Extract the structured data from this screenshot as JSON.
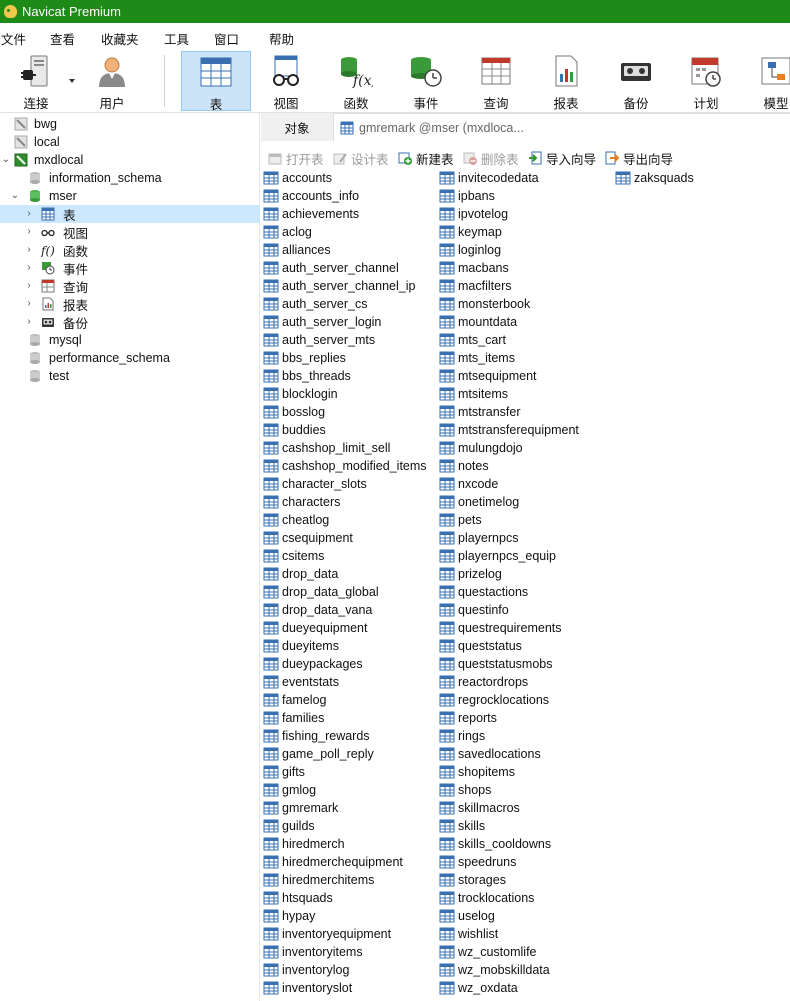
{
  "window": {
    "title": "Navicat Premium"
  },
  "menu": [
    "文件",
    "查看",
    "收藏夹",
    "工具",
    "窗口",
    "帮助"
  ],
  "toolbar": [
    {
      "label": "连接",
      "icon": "connection-plug-icon"
    },
    {
      "label": "用户",
      "icon": "user-icon"
    },
    {
      "label": "表",
      "icon": "table-icon",
      "active": true
    },
    {
      "label": "视图",
      "icon": "view-glasses-icon"
    },
    {
      "label": "函数",
      "icon": "function-icon"
    },
    {
      "label": "事件",
      "icon": "event-clock-icon"
    },
    {
      "label": "查询",
      "icon": "query-icon"
    },
    {
      "label": "报表",
      "icon": "report-icon"
    },
    {
      "label": "备份",
      "icon": "backup-icon"
    },
    {
      "label": "计划",
      "icon": "schedule-calendar-icon"
    },
    {
      "label": "模型",
      "icon": "model-icon"
    }
  ],
  "tree": {
    "connections": [
      {
        "label": "bwg"
      },
      {
        "label": "local"
      },
      {
        "label": "mxdlocal"
      }
    ],
    "databases": [
      {
        "label": "information_schema"
      },
      {
        "label": "mser"
      }
    ],
    "mser_children": [
      {
        "label": "表",
        "icon": "table-icon"
      },
      {
        "label": "视图",
        "icon": "view-glasses-icon"
      },
      {
        "label": "函数",
        "icon": "function-icon"
      },
      {
        "label": "事件",
        "icon": "event-clock-icon"
      },
      {
        "label": "查询",
        "icon": "query-icon"
      },
      {
        "label": "报表",
        "icon": "report-icon"
      },
      {
        "label": "备份",
        "icon": "backup-icon"
      }
    ],
    "other_databases": [
      {
        "label": "mysql"
      },
      {
        "label": "performance_schema"
      },
      {
        "label": "test"
      }
    ]
  },
  "object_tab": {
    "label": "对象",
    "doc_tab_label": "gmremark @mser (mxdloca..."
  },
  "actions": [
    {
      "label": "打开表",
      "enabled": false,
      "icon": "open-table-icon"
    },
    {
      "label": "设计表",
      "enabled": false,
      "icon": "design-table-icon"
    },
    {
      "label": "新建表",
      "enabled": true,
      "icon": "new-table-icon"
    },
    {
      "label": "删除表",
      "enabled": false,
      "icon": "delete-table-icon"
    },
    {
      "label": "导入向导",
      "enabled": true,
      "icon": "import-wizard-icon"
    },
    {
      "label": "导出向导",
      "enabled": true,
      "icon": "export-wizard-icon"
    }
  ],
  "tables": {
    "col1": [
      "accounts",
      "accounts_info",
      "achievements",
      "aclog",
      "alliances",
      "auth_server_channel",
      "auth_server_channel_ip",
      "auth_server_cs",
      "auth_server_login",
      "auth_server_mts",
      "bbs_replies",
      "bbs_threads",
      "blocklogin",
      "bosslog",
      "buddies",
      "cashshop_limit_sell",
      "cashshop_modified_items",
      "character_slots",
      "characters",
      "cheatlog",
      "csequipment",
      "csitems",
      "drop_data",
      "drop_data_global",
      "drop_data_vana",
      "dueyequipment",
      "dueyitems",
      "dueypackages",
      "eventstats",
      "famelog",
      "families",
      "fishing_rewards",
      "game_poll_reply",
      "gifts",
      "gmlog",
      "gmremark",
      "guilds",
      "hiredmerch",
      "hiredmerchequipment",
      "hiredmerchitems",
      "htsquads",
      "hypay",
      "inventoryequipment",
      "inventoryitems",
      "inventorylog",
      "inventoryslot"
    ],
    "col2": [
      "invitecodedata",
      "ipbans",
      "ipvotelog",
      "keymap",
      "loginlog",
      "macbans",
      "macfilters",
      "monsterbook",
      "mountdata",
      "mts_cart",
      "mts_items",
      "mtsequipment",
      "mtsitems",
      "mtstransfer",
      "mtstransferequipment",
      "mulungdojo",
      "notes",
      "nxcode",
      "onetimelog",
      "pets",
      "playernpcs",
      "playernpcs_equip",
      "prizelog",
      "questactions",
      "questinfo",
      "questrequirements",
      "queststatus",
      "queststatusmobs",
      "reactordrops",
      "regrocklocations",
      "reports",
      "rings",
      "savedlocations",
      "shopitems",
      "shops",
      "skillmacros",
      "skills",
      "skills_cooldowns",
      "speedruns",
      "storages",
      "trocklocations",
      "uselog",
      "wishlist",
      "wz_customlife",
      "wz_mobskilldata",
      "wz_oxdata"
    ],
    "col3": [
      "zaksquads"
    ]
  },
  "colors": {
    "titlebar": "#1e8a17",
    "selection": "#cce8ff",
    "toolbar_active": "#cce4f7"
  }
}
